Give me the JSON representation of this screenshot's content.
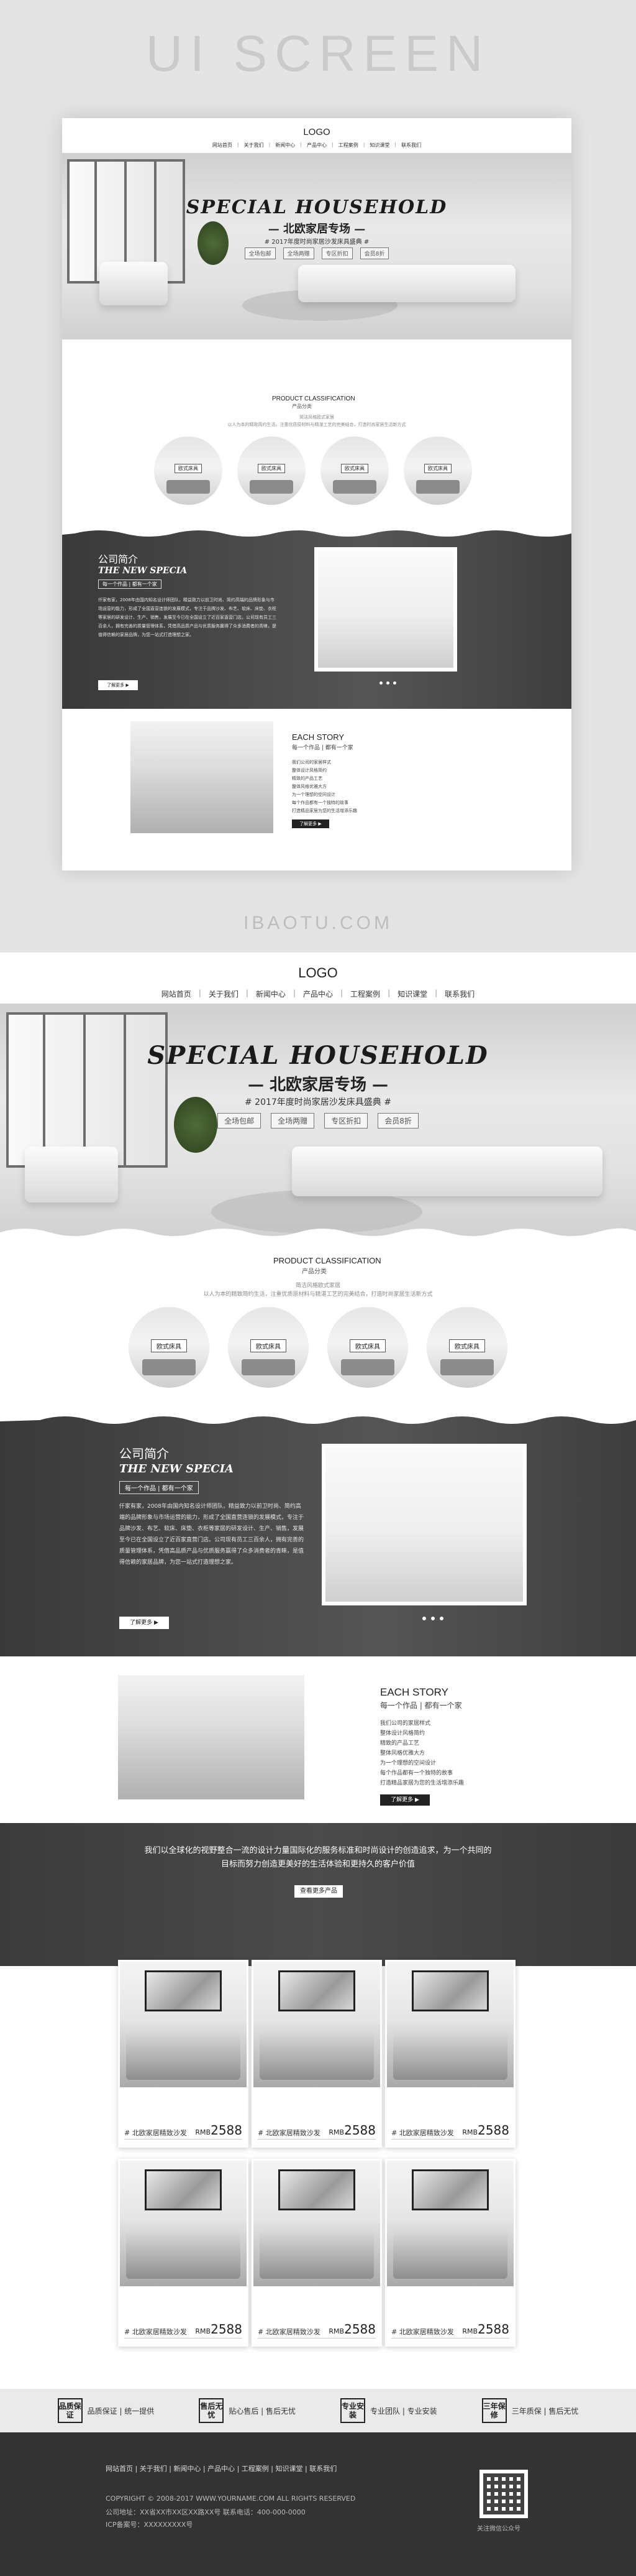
{
  "screen_title": "UI SCREEN",
  "watermark": "IBAOTU.COM",
  "logo": "LOGO",
  "nav": [
    "网站首页",
    "关于我们",
    "新闻中心",
    "产品中心",
    "工程案例",
    "知识课堂",
    "联系我们"
  ],
  "nav_sep": "|",
  "hero": {
    "title": "SPECIAL HOUSEHOLD",
    "subtitle": "— 北欧家居专场 —",
    "tagline": "# 2017年度时尚家居沙发床具盛典 #",
    "tags": [
      "全场包邮",
      "全场两赠",
      "专区折扣",
      "会员8折"
    ]
  },
  "product_classification": {
    "title": "PRODUCT  CLASSIFICATION",
    "subtitle": "产品分类",
    "desc_line1": "简洁风格欧式家居",
    "desc_line2": "以人为本的精致简约生活，注重优质原材料与精湛工艺的完美结合，打造时尚家居生活新方式",
    "items": [
      "欧式床具",
      "欧式床具",
      "欧式床具",
      "欧式床具"
    ]
  },
  "about": {
    "heading": "公司简介",
    "english": "THE NEW SPECIA",
    "badge": "每一个作品 | 都有一个家",
    "text": "仟家有家，2008年由国内知名设计师团队，精益致力以前卫时尚、简约高端的品牌形象与市场运营的能力，形成了全国直营连锁的发展模式，专注于品牌沙发、布艺、软床、床垫、衣柜等家居的研发设计、生产、销售，发展至今已在全国设立了近百家直营门店。公司现有员工三百余人，拥有完善的质量管理体系，凭借高品质产品与优质服务赢得了众多消费者的青睐，是值得信赖的家居品牌，为您一站式打造理想之家。",
    "button": "了解更多 ▶"
  },
  "story": {
    "heading": "EACH STORY",
    "subheading": "每一个作品 | 都有一个家",
    "items": [
      "我们公司的家居样式",
      "整体设计风格简约",
      "精致的产品工艺",
      "整体风格优雅大方",
      "为一个理想的空间设计",
      "每个作品都有一个独特的故事",
      "打造精品家居为您的生活增添乐趣"
    ],
    "button": "了解更多 ▶"
  },
  "banner": {
    "text_line1": "我们以全球化的视野整合一流的设计力量国际化的服务标准和时尚设计的创造追求，为一个共同的",
    "text_line2": "目标而努力创造更美好的生活体验和更持久的客户价值",
    "button": "查看更多产品"
  },
  "products": [
    {
      "name": "# 北欧家居精致沙发",
      "currency": "RMB",
      "price": "2588"
    },
    {
      "name": "# 北欧家居精致沙发",
      "currency": "RMB",
      "price": "2588"
    },
    {
      "name": "# 北欧家居精致沙发",
      "currency": "RMB",
      "price": "2588"
    },
    {
      "name": "# 北欧家居精致沙发",
      "currency": "RMB",
      "price": "2588"
    },
    {
      "name": "# 北欧家居精致沙发",
      "currency": "RMB",
      "price": "2588"
    },
    {
      "name": "# 北欧家居精致沙发",
      "currency": "RMB",
      "price": "2588"
    }
  ],
  "features": [
    {
      "icon": "品质保证",
      "label": "品质保证 | 统一提供"
    },
    {
      "icon": "售后无忧",
      "label": "贴心售后 | 售后无忧"
    },
    {
      "icon": "专业安装",
      "label": "专业团队 | 专业安装"
    },
    {
      "icon": "三年保修",
      "label": "三年质保 | 售后无忧"
    }
  ],
  "footer": {
    "links": "网站首页 | 关于我们 | 新闻中心 | 产品中心 | 工程案例 | 知识课堂 | 联系我们",
    "copyright": "COPYRIGHT © 2008-2017 WWW.YOURNAME.COM ALL RIGHTS RESERVED",
    "address": "公司地址：XX省XX市XX区XX路XX号  联系电话：400-000-0000",
    "icp": "ICP备案号：XXXXXXXXX号",
    "qr_caption": "关注微信公众号"
  }
}
